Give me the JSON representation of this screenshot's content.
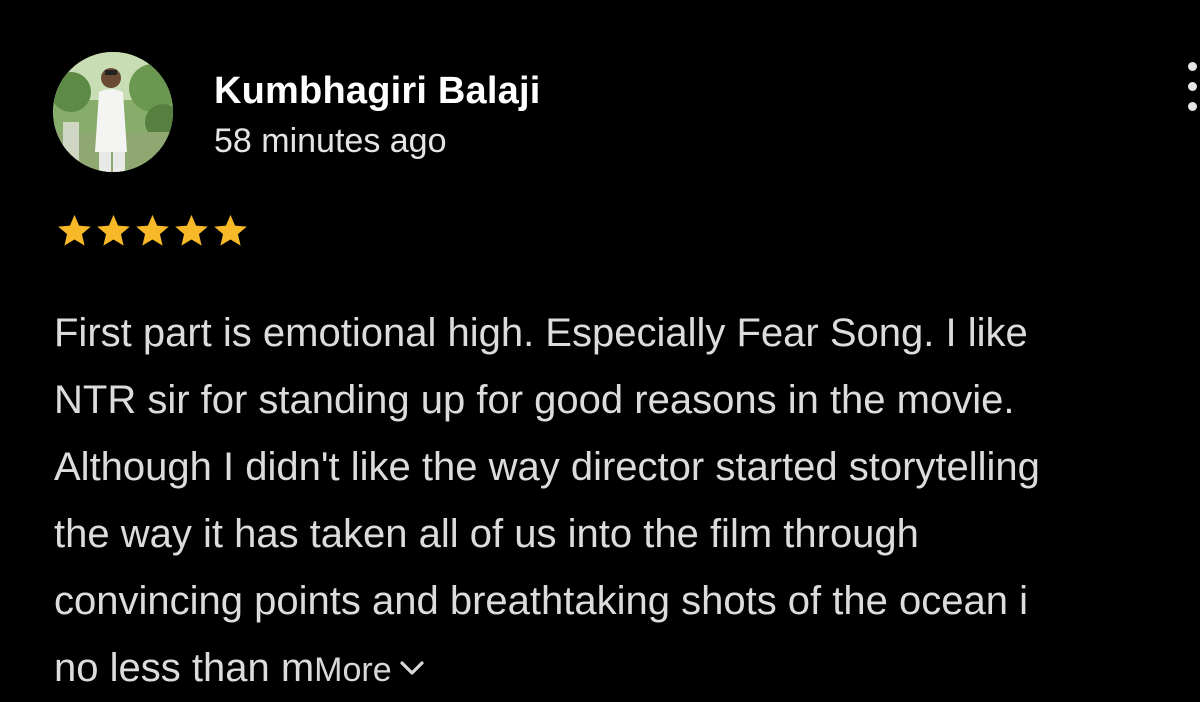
{
  "review": {
    "reviewer_name": "Kumbhagiri Balaji",
    "time_ago": "58 minutes ago",
    "rating": 5,
    "rating_max": 5,
    "text_lines": [
      "First part is emotional high. Especially Fear Song. I like",
      "NTR sir for standing up for good reasons in the movie.",
      "Although I didn't like the way director started storytelling",
      "the way it has taken all of us into the film through",
      "convincing points and breathtaking shots of the ocean i",
      "no less than m"
    ],
    "more_label": "More",
    "icons": {
      "avatar": "user-photo-avatar",
      "menu": "more-vert-icon",
      "star": "star-icon",
      "expand": "chevron-down-icon"
    },
    "colors": {
      "background": "#000000",
      "star": "#f7b928",
      "name": "#ffffff",
      "text": "#dcdcdc"
    }
  }
}
